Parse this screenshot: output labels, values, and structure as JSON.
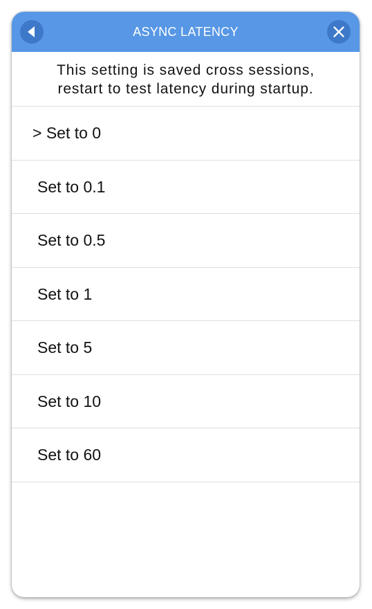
{
  "dialog": {
    "title": "ASYNC LATENCY",
    "description_line1": "This setting is saved cross sessions,",
    "description_line2": "restart to test latency during startup.",
    "back_icon": "back-arrow-icon",
    "close_icon": "close-icon",
    "header_color": "#5797e5",
    "button_color": "#3d78c9"
  },
  "options": [
    {
      "label": "> Set to 0",
      "selected": true
    },
    {
      "label": "Set to 0.1",
      "selected": false
    },
    {
      "label": "Set to 0.5",
      "selected": false
    },
    {
      "label": "Set to 1",
      "selected": false
    },
    {
      "label": "Set to 5",
      "selected": false
    },
    {
      "label": "Set to 10",
      "selected": false
    },
    {
      "label": "Set to 60",
      "selected": false
    }
  ]
}
